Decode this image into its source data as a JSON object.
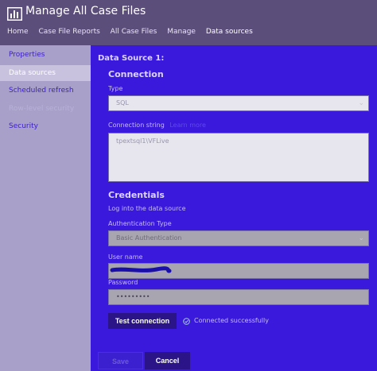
{
  "header": {
    "title": "Manage All Case Files",
    "breadcrumb": [
      "Home",
      "Case File Reports",
      "All Case Files",
      "Manage",
      "Data sources"
    ]
  },
  "sidebar": {
    "items": [
      {
        "label": "Properties"
      },
      {
        "label": "Data sources"
      },
      {
        "label": "Scheduled refresh"
      },
      {
        "label": "Row-level security"
      },
      {
        "label": "Security"
      }
    ]
  },
  "main": {
    "section_title": "Data Source 1:",
    "connection_heading": "Connection",
    "type_label": "Type",
    "type_value": "SQL",
    "conn_string_label": "Connection string",
    "conn_string_link": "Learn more",
    "conn_string_value": "tpextsql1\\VFLive",
    "credentials_heading": "Credentials",
    "credentials_desc": "Log into the data source",
    "auth_type_label": "Authentication Type",
    "auth_type_value": "Basic Authentication",
    "username_label": "User name",
    "password_label": "Password",
    "password_value": "•••••••••",
    "test_button": "Test connection",
    "status_text": "Connected successfully",
    "save_button": "Save",
    "cancel_button": "Cancel"
  }
}
